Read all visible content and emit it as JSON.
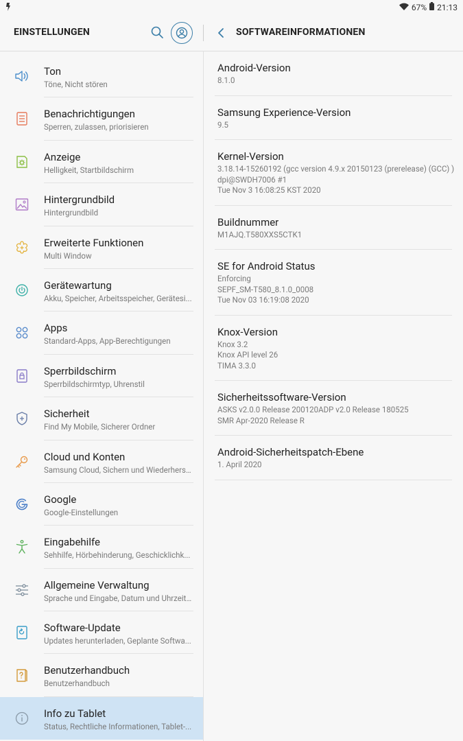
{
  "status_bar": {
    "battery": "67%",
    "time": "21:13"
  },
  "left_header": {
    "title": "EINSTELLUNGEN"
  },
  "right_header": {
    "title": "SOFTWAREINFORMATIONEN"
  },
  "colors": {
    "accent": "#3b7ea8",
    "selected_bg": "#cfe3f4",
    "background": "#f7f7f7"
  },
  "menu": [
    {
      "title": "Ton",
      "subtitle": "Töne, Nicht stören",
      "icon": "sound-icon",
      "color": "#4a8ecb"
    },
    {
      "title": "Benachrichtigungen",
      "subtitle": "Sperren, zulassen, priorisieren",
      "icon": "notifications-icon",
      "color": "#e67a5c"
    },
    {
      "title": "Anzeige",
      "subtitle": "Helligkeit, Startbildschirm",
      "icon": "display-icon",
      "color": "#8cbf45"
    },
    {
      "title": "Hintergrundbild",
      "subtitle": "Hintergrundbild",
      "icon": "wallpaper-icon",
      "color": "#b07cc8"
    },
    {
      "title": "Erweiterte Funktionen",
      "subtitle": "Multi Window",
      "icon": "advanced-features-icon",
      "color": "#e3b23c"
    },
    {
      "title": "Gerätewartung",
      "subtitle": "Akku, Speicher, Arbeitsspeicher, Gerätesi...",
      "icon": "device-care-icon",
      "color": "#3fb1a8"
    },
    {
      "title": "Apps",
      "subtitle": "Standard-Apps, App-Berechtigungen",
      "icon": "apps-icon",
      "color": "#5a8ccc"
    },
    {
      "title": "Sperrbildschirm",
      "subtitle": "Sperrbildschirmtyp, Uhrenstil",
      "icon": "lock-screen-icon",
      "color": "#8a7cc8"
    },
    {
      "title": "Sicherheit",
      "subtitle": "Find My Mobile, Sicherer Ordner",
      "icon": "security-icon",
      "color": "#6a7ea8"
    },
    {
      "title": "Cloud und Konten",
      "subtitle": "Samsung Cloud, Sichern und Wiederhers...",
      "icon": "key-icon",
      "color": "#e89a4a"
    },
    {
      "title": "Google",
      "subtitle": "Google-Einstellungen",
      "icon": "google-icon",
      "color": "#4a7ec8"
    },
    {
      "title": "Eingabehilfe",
      "subtitle": "Sehhilfe, Hörbehinderung, Geschicklichk...",
      "icon": "accessibility-icon",
      "color": "#5ab05a"
    },
    {
      "title": "Allgemeine Verwaltung",
      "subtitle": "Sprache und Eingabe, Datum und Uhrzeit...",
      "icon": "sliders-icon",
      "color": "#7a8a99"
    },
    {
      "title": "Software-Update",
      "subtitle": "Updates herunterladen, Geplante Softwa...",
      "icon": "software-update-icon",
      "color": "#3b9ec8"
    },
    {
      "title": "Benutzerhandbuch",
      "subtitle": "Benutzerhandbuch",
      "icon": "user-manual-icon",
      "color": "#d49a3a"
    },
    {
      "title": "Info zu Tablet",
      "subtitle": "Status, Rechtliche Informationen, Tablet-...",
      "icon": "info-icon",
      "color": "#8a9aa8",
      "selected": true
    }
  ],
  "software_info": [
    {
      "title": "Android-Version",
      "lines": [
        "8.1.0"
      ]
    },
    {
      "title": "Samsung Experience-Version",
      "lines": [
        "9.5"
      ]
    },
    {
      "title": "Kernel-Version",
      "lines": [
        "3.18.14-15260192 (gcc version 4.9.x 20150123 (prerelease) (GCC) )",
        "dpi@SWDH7006 #1",
        "Tue Nov 3 16:08:25 KST 2020"
      ]
    },
    {
      "title": "Buildnummer",
      "lines": [
        "M1AJQ.T580XXS5CTK1"
      ]
    },
    {
      "title": "SE for Android Status",
      "lines": [
        "Enforcing",
        "SEPF_SM-T580_8.1.0_0008",
        "Tue Nov 03 16:19:08 2020"
      ]
    },
    {
      "title": "Knox-Version",
      "lines": [
        "Knox 3.2",
        "Knox API level 26",
        "TIMA 3.3.0"
      ]
    },
    {
      "title": "Sicherheitssoftware-Version",
      "lines": [
        "ASKS v2.0.0 Release 200120ADP v2.0 Release 180525",
        "SMR Apr-2020 Release R"
      ]
    },
    {
      "title": "Android-Sicherheitspatch-Ebene",
      "lines": [
        "1. April 2020"
      ]
    }
  ]
}
